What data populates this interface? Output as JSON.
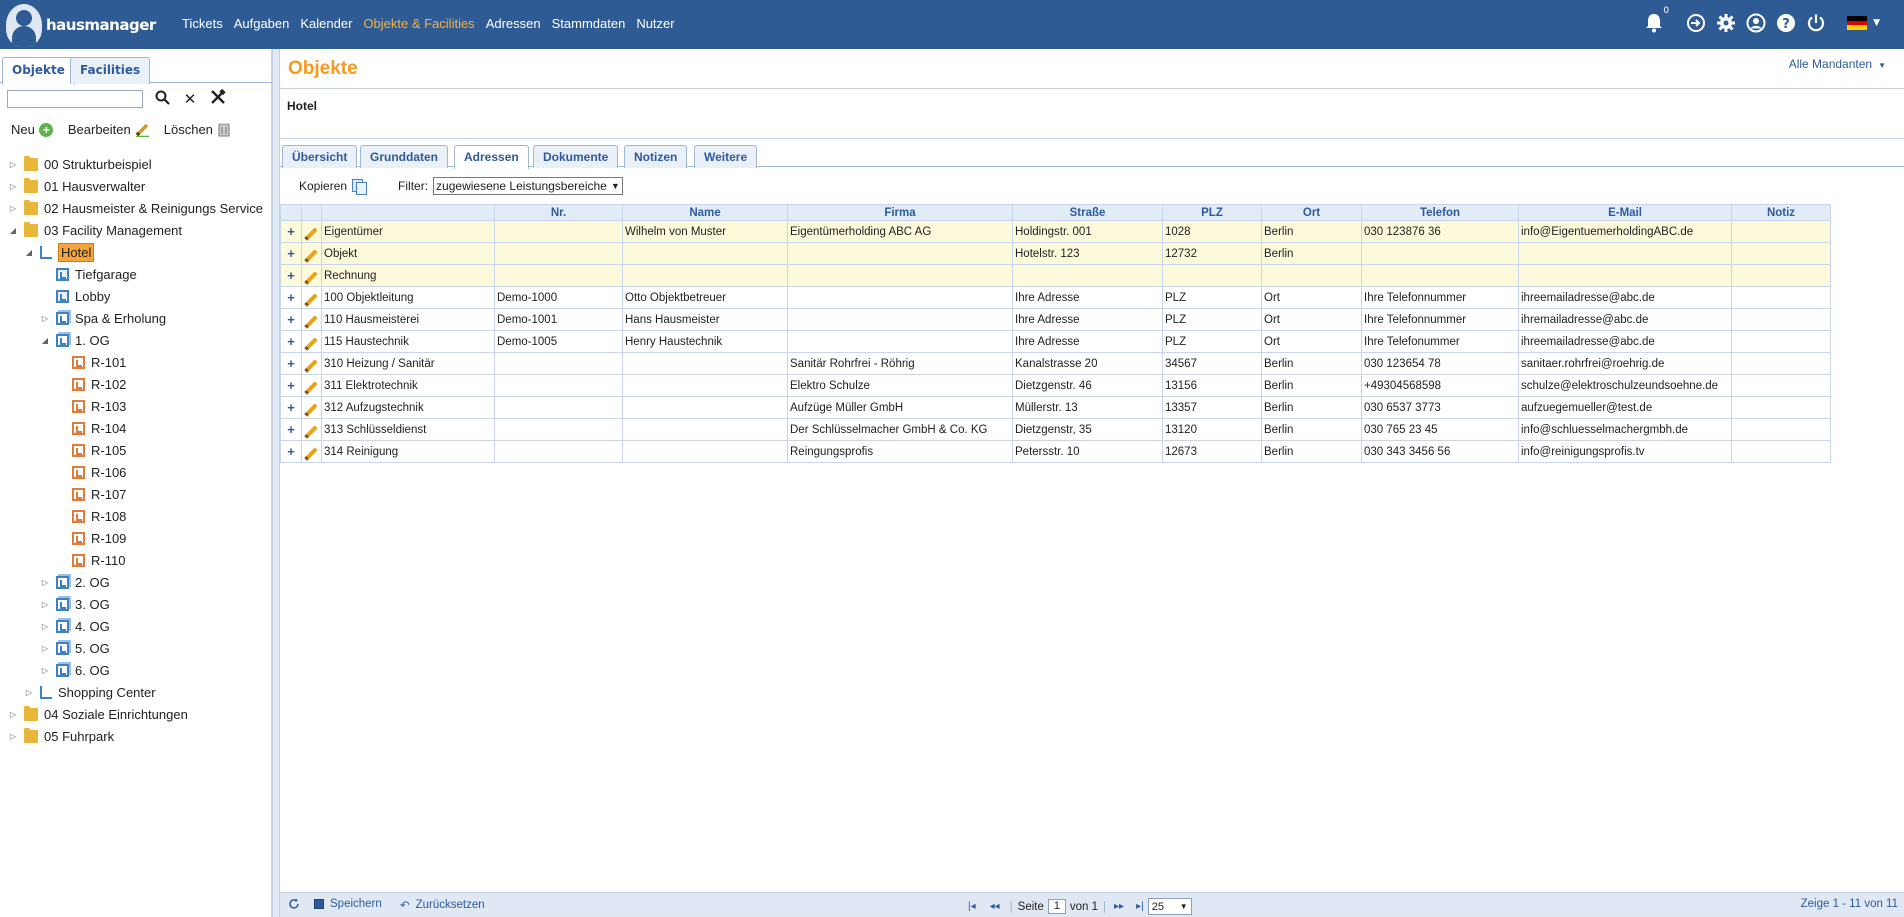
{
  "app": {
    "logo_text": "hausmanager",
    "language_flag": "de-flag",
    "notification_count": "0"
  },
  "topnav": [
    {
      "label": "Tickets",
      "active": false
    },
    {
      "label": "Aufgaben",
      "active": false
    },
    {
      "label": "Kalender",
      "active": false
    },
    {
      "label": "Objekte & Facilities",
      "active": true
    },
    {
      "label": "Adressen",
      "active": false
    },
    {
      "label": "Stammdaten",
      "active": false
    },
    {
      "label": "Nutzer",
      "active": false
    }
  ],
  "topicons": [
    "bell-icon",
    "login-icon",
    "gear-icon",
    "user-icon",
    "help-icon",
    "power-icon"
  ],
  "left": {
    "tabs": [
      "Objekte",
      "Facilities"
    ],
    "search_value": "",
    "actions": {
      "new": "Neu",
      "edit": "Bearbeiten",
      "delete": "Löschen"
    },
    "tree": [
      {
        "label": "00 Strukturbeispiel",
        "level": 0,
        "icon": "folder",
        "toggle": "closed"
      },
      {
        "label": "01 Hausverwalter",
        "level": 0,
        "icon": "folder",
        "toggle": "closed"
      },
      {
        "label": "02 Hausmeister & Reinigungs Service",
        "level": 0,
        "icon": "folder",
        "toggle": "closed"
      },
      {
        "label": "03 Facility Management",
        "level": 0,
        "icon": "folder",
        "toggle": "open"
      },
      {
        "label": "Hotel",
        "level": 1,
        "icon": "lshape",
        "toggle": "open",
        "selected": true
      },
      {
        "label": "Tiefgarage",
        "level": 2,
        "icon": "roomicon",
        "toggle": "none"
      },
      {
        "label": "Lobby",
        "level": 2,
        "icon": "roomicon",
        "toggle": "none"
      },
      {
        "label": "Spa & Erholung",
        "level": 2,
        "icon": "floorstack",
        "toggle": "closed"
      },
      {
        "label": "1. OG",
        "level": 2,
        "icon": "floorstack",
        "toggle": "open"
      },
      {
        "label": "R-101",
        "level": 3,
        "icon": "rroom",
        "toggle": "none"
      },
      {
        "label": "R-102",
        "level": 3,
        "icon": "rroom",
        "toggle": "none"
      },
      {
        "label": "R-103",
        "level": 3,
        "icon": "rroom",
        "toggle": "none"
      },
      {
        "label": "R-104",
        "level": 3,
        "icon": "rroom",
        "toggle": "none"
      },
      {
        "label": "R-105",
        "level": 3,
        "icon": "rroom",
        "toggle": "none"
      },
      {
        "label": "R-106",
        "level": 3,
        "icon": "rroom",
        "toggle": "none"
      },
      {
        "label": "R-107",
        "level": 3,
        "icon": "rroom",
        "toggle": "none"
      },
      {
        "label": "R-108",
        "level": 3,
        "icon": "rroom",
        "toggle": "none"
      },
      {
        "label": "R-109",
        "level": 3,
        "icon": "rroom",
        "toggle": "none"
      },
      {
        "label": "R-110",
        "level": 3,
        "icon": "rroom",
        "toggle": "none"
      },
      {
        "label": "2. OG",
        "level": 2,
        "icon": "floorstack",
        "toggle": "closed"
      },
      {
        "label": "3. OG",
        "level": 2,
        "icon": "floorstack",
        "toggle": "closed"
      },
      {
        "label": "4. OG",
        "level": 2,
        "icon": "floorstack",
        "toggle": "closed"
      },
      {
        "label": "5. OG",
        "level": 2,
        "icon": "floorstack",
        "toggle": "closed"
      },
      {
        "label": "6. OG",
        "level": 2,
        "icon": "floorstack",
        "toggle": "closed"
      },
      {
        "label": "Shopping Center",
        "level": 1,
        "icon": "lshape",
        "toggle": "closed"
      },
      {
        "label": "04 Soziale Einrichtungen",
        "level": 0,
        "icon": "folder",
        "toggle": "closed"
      },
      {
        "label": "05 Fuhrpark",
        "level": 0,
        "icon": "folder",
        "toggle": "closed"
      }
    ]
  },
  "main": {
    "title": "Objekte",
    "mandanten": "Alle Mandanten",
    "object_name": "Hotel",
    "tabs": [
      "Übersicht",
      "Grunddaten",
      "Adressen",
      "Dokumente",
      "Notizen",
      "Weitere"
    ],
    "active_tab": "Adressen",
    "copy_label": "Kopieren",
    "filter_label": "Filter:",
    "filter_value": "zugewiesene Leistungsbereiche",
    "columns": [
      "",
      "",
      "",
      "Nr.",
      "Name",
      "Firma",
      "Straße",
      "PLZ",
      "Ort",
      "Telefon",
      "E-Mail",
      "Notiz"
    ],
    "rows": [
      {
        "hl": true,
        "cells": [
          "Eigentümer",
          "",
          "Wilhelm von Muster",
          "Eigentümerholding ABC AG",
          "Holdingstr. 001",
          "1028",
          "Berlin",
          "030 123876 36",
          "info@EigentuemerholdingABC.de",
          ""
        ]
      },
      {
        "hl": true,
        "cells": [
          "Objekt",
          "",
          "",
          "",
          "Hotelstr. 123",
          "12732",
          "Berlin",
          "",
          "",
          ""
        ]
      },
      {
        "hl": true,
        "cells": [
          "Rechnung",
          "",
          "",
          "",
          "",
          "",
          "",
          "",
          "",
          ""
        ]
      },
      {
        "hl": false,
        "cells": [
          "100 Objektleitung",
          "Demo-1000",
          "Otto Objektbetreuer",
          "",
          "Ihre Adresse",
          "PLZ",
          "Ort",
          "Ihre Telefonnummer",
          "ihreemailadresse@abc.de",
          ""
        ]
      },
      {
        "hl": false,
        "cells": [
          "110 Hausmeisterei",
          "Demo-1001",
          "Hans Hausmeister",
          "",
          "Ihre Adresse",
          "PLZ",
          "Ort",
          "Ihre Telefonnummer",
          "ihremailadresse@abc.de",
          ""
        ]
      },
      {
        "hl": false,
        "cells": [
          "115 Haustechnik",
          "Demo-1005",
          "Henry Haustechnik",
          "",
          "Ihre Adresse",
          "PLZ",
          "Ort",
          "Ihre Telefonummer",
          "ihreemailadresse@abc.de",
          ""
        ]
      },
      {
        "hl": false,
        "cells": [
          "310 Heizung / Sanitär",
          "",
          "",
          "Sanitär Rohrfrei - Röhrig",
          "Kanalstrasse 20",
          "34567",
          "Berlin",
          "030 123654 78",
          "sanitaer.rohrfrei@roehrig.de",
          ""
        ]
      },
      {
        "hl": false,
        "cells": [
          "311 Elektrotechnik",
          "",
          "",
          "Elektro Schulze",
          "Dietzgenstr. 46",
          "13156",
          "Berlin",
          "+49304568598",
          "schulze@elektroschulzeundsoehne.de",
          ""
        ]
      },
      {
        "hl": false,
        "cells": [
          "312 Aufzugstechnik",
          "",
          "",
          "Aufzüge Müller GmbH",
          "Müllerstr. 13",
          "13357",
          "Berlin",
          "030 6537 3773",
          "aufzuegemueller@test.de",
          ""
        ]
      },
      {
        "hl": false,
        "cells": [
          "313 Schlüsseldienst",
          "",
          "",
          "Der Schlüsselmacher GmbH & Co. KG",
          "Dietzgenstr, 35",
          "13120",
          "Berlin",
          "030 765 23 45",
          "info@schluesselmachergmbh.de",
          ""
        ]
      },
      {
        "hl": false,
        "cells": [
          "314 Reinigung",
          "",
          "",
          "Reingungsprofis",
          "Petersstr. 10",
          "12673",
          "Berlin",
          "030 343 3456 56",
          "info@reinigungsprofis.tv",
          ""
        ]
      }
    ]
  },
  "pager": {
    "save": "Speichern",
    "reset": "Zurücksetzen",
    "page_label": "Seite",
    "page": "1",
    "of_label": "von 1",
    "page_size": "25",
    "summary": "Zeige 1 - 11 von 11"
  }
}
